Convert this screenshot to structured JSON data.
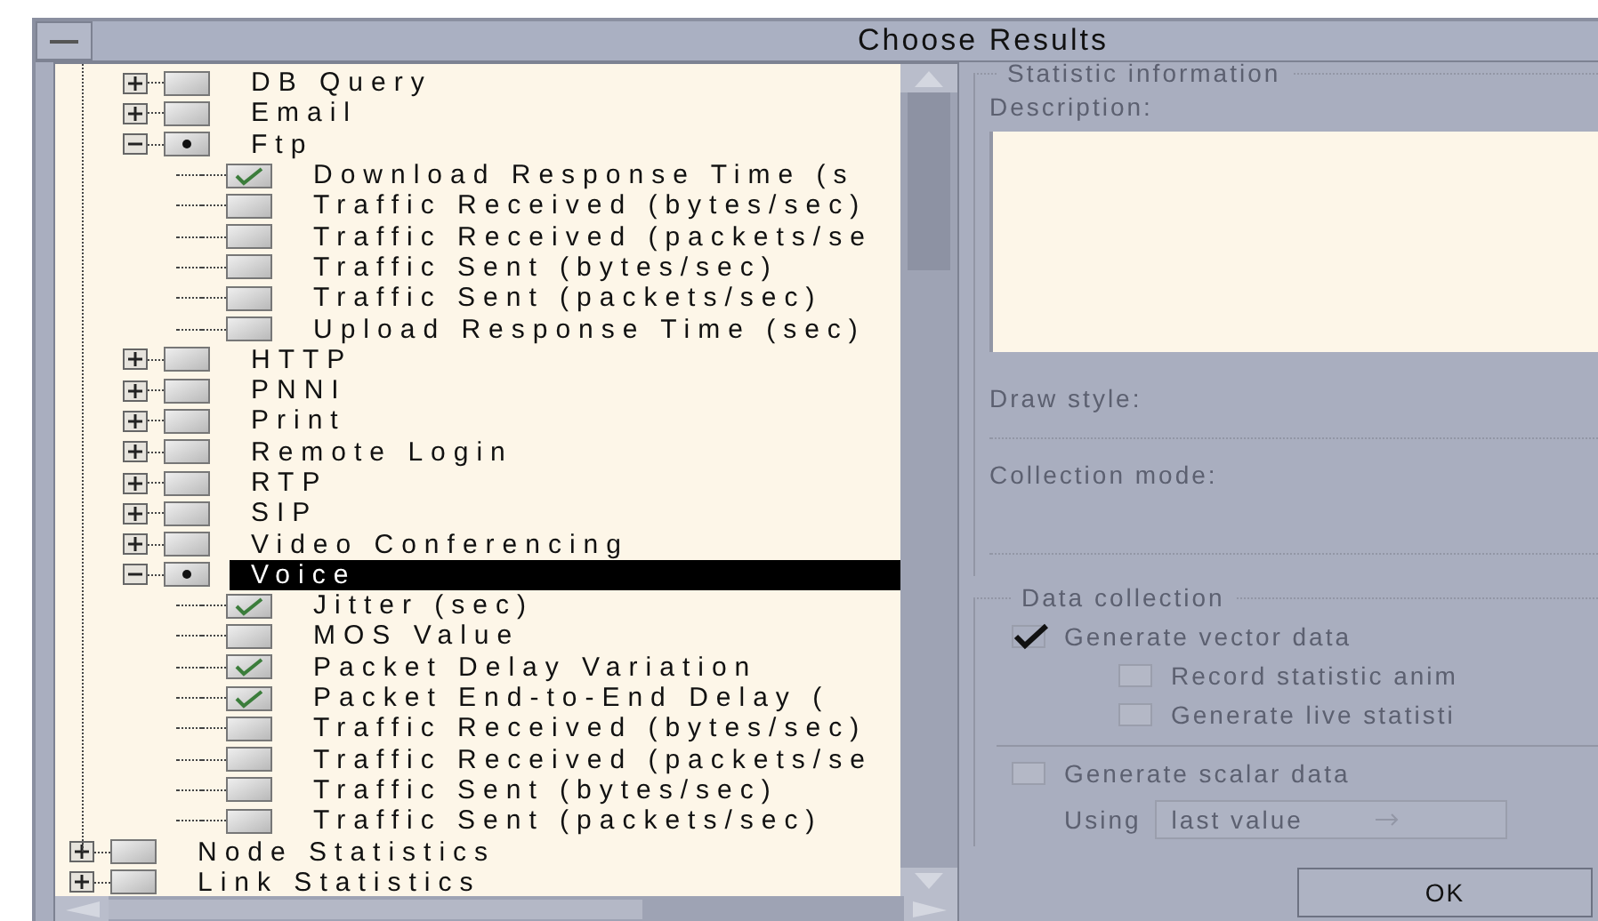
{
  "window": {
    "title": "Choose Results"
  },
  "tree": {
    "continued_children": [
      {
        "label": "DB Query",
        "checked": false,
        "partial": false,
        "expanded": false,
        "selected": false
      },
      {
        "label": "Email",
        "checked": false,
        "partial": false,
        "expanded": false,
        "selected": false
      },
      {
        "label": "Ftp",
        "checked": false,
        "partial": true,
        "expanded": true,
        "selected": false,
        "children": [
          {
            "label": "Download Response Time (s",
            "checked": true,
            "partial": false,
            "selected": false
          },
          {
            "label": "Traffic Received (bytes/sec)",
            "checked": false,
            "partial": false,
            "selected": false
          },
          {
            "label": "Traffic Received (packets/se",
            "checked": false,
            "partial": false,
            "selected": false
          },
          {
            "label": "Traffic Sent (bytes/sec)",
            "checked": false,
            "partial": false,
            "selected": false
          },
          {
            "label": "Traffic Sent (packets/sec)",
            "checked": false,
            "partial": false,
            "selected": false
          },
          {
            "label": "Upload Response Time (sec)",
            "checked": false,
            "partial": false,
            "selected": false
          }
        ]
      },
      {
        "label": "HTTP",
        "checked": false,
        "partial": false,
        "expanded": false,
        "selected": false
      },
      {
        "label": "PNNI",
        "checked": false,
        "partial": false,
        "expanded": false,
        "selected": false
      },
      {
        "label": "Print",
        "checked": false,
        "partial": false,
        "expanded": false,
        "selected": false
      },
      {
        "label": "Remote Login",
        "checked": false,
        "partial": false,
        "expanded": false,
        "selected": false
      },
      {
        "label": "RTP",
        "checked": false,
        "partial": false,
        "expanded": false,
        "selected": false
      },
      {
        "label": "SIP",
        "checked": false,
        "partial": false,
        "expanded": false,
        "selected": false
      },
      {
        "label": "Video Conferencing",
        "checked": false,
        "partial": false,
        "expanded": false,
        "selected": false
      },
      {
        "label": "Voice",
        "checked": false,
        "partial": true,
        "expanded": true,
        "selected": true,
        "children": [
          {
            "label": "Jitter (sec)",
            "checked": true,
            "partial": false,
            "selected": false
          },
          {
            "label": "MOS Value",
            "checked": false,
            "partial": false,
            "selected": false
          },
          {
            "label": "Packet Delay Variation",
            "checked": true,
            "partial": false,
            "selected": false
          },
          {
            "label": "Packet End-to-End Delay (",
            "checked": true,
            "partial": false,
            "selected": false
          },
          {
            "label": "Traffic Received (bytes/sec)",
            "checked": false,
            "partial": false,
            "selected": false
          },
          {
            "label": "Traffic Received (packets/se",
            "checked": false,
            "partial": false,
            "selected": false
          },
          {
            "label": "Traffic Sent (bytes/sec)",
            "checked": false,
            "partial": false,
            "selected": false
          },
          {
            "label": "Traffic Sent (packets/sec)",
            "checked": false,
            "partial": false,
            "selected": false
          }
        ]
      }
    ],
    "items": [
      {
        "label": "Node Statistics",
        "checked": false,
        "partial": false,
        "expanded": false,
        "selected": false
      },
      {
        "label": "Link Statistics",
        "checked": false,
        "partial": false,
        "expanded": false,
        "selected": false
      }
    ]
  },
  "statistic_information": {
    "legend": "Statistic information",
    "description_label": "Description:",
    "draw_style_label": "Draw style:",
    "collection_mode_label": "Collection mode:"
  },
  "data_collection": {
    "legend": "Data collection",
    "options": [
      {
        "label": "Generate vector data",
        "checked": true,
        "disabled": true,
        "indented": false
      },
      {
        "label": "Record statistic anim",
        "checked": false,
        "disabled": true,
        "indented": true
      },
      {
        "label": "Generate live statisti",
        "checked": false,
        "disabled": true,
        "indented": true
      }
    ],
    "scalar": {
      "label": "Generate scalar data",
      "checked": false,
      "disabled": true
    },
    "using_label": "Using",
    "using_value": "last value"
  },
  "buttons": [
    {
      "label": "OK"
    }
  ]
}
